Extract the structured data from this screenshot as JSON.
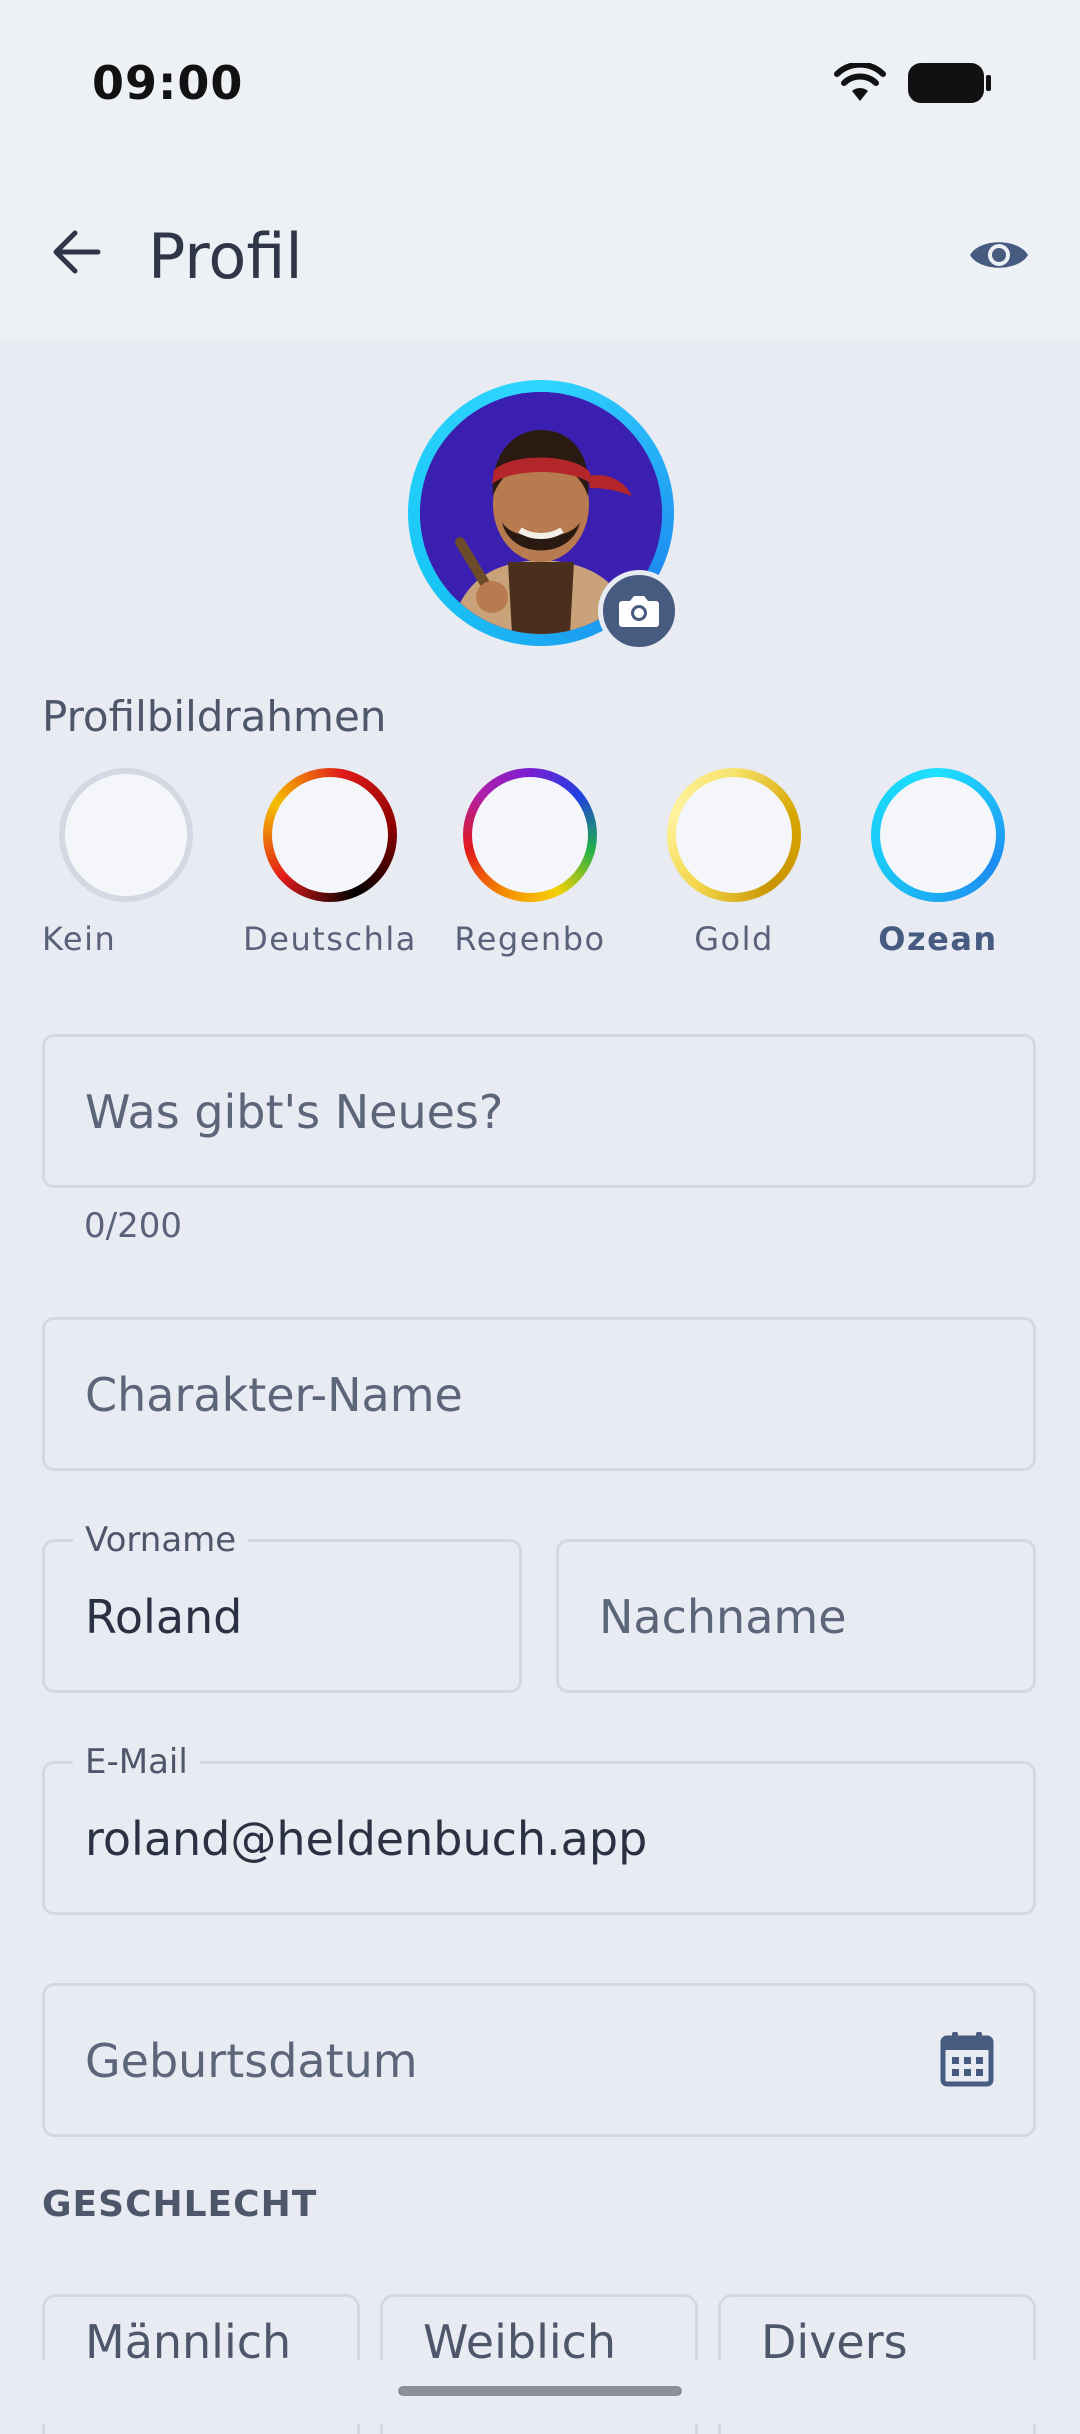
{
  "status_bar": {
    "time": "09:00",
    "wifi_icon": "wifi-icon",
    "battery_icon": "battery-icon"
  },
  "app_bar": {
    "title": "Profil",
    "back_icon": "arrow-left-icon",
    "preview_icon": "eye-icon"
  },
  "avatar": {
    "ring_colors": [
      "#2fd6ff",
      "#1e8cf0"
    ],
    "camera_icon": "camera-icon"
  },
  "frames": {
    "label": "Profilbildrahmen",
    "items": [
      {
        "label": "Kein",
        "selected": false
      },
      {
        "label": "Deutschla",
        "selected": false
      },
      {
        "label": "Regenbo",
        "selected": false
      },
      {
        "label": "Gold",
        "selected": false
      },
      {
        "label": "Ozean",
        "selected": true
      }
    ]
  },
  "status_field": {
    "placeholder": "Was gibt's Neues?",
    "counter": "0/200"
  },
  "character_field": {
    "placeholder": "Charakter-Name"
  },
  "first_name": {
    "label": "Vorname",
    "value": "Roland"
  },
  "last_name": {
    "placeholder": "Nachname"
  },
  "email": {
    "label": "E-Mail",
    "value": "roland@heldenbuch.app"
  },
  "birthdate": {
    "placeholder": "Geburtsdatum",
    "icon": "calendar-icon"
  },
  "gender": {
    "title": "GESCHLECHT",
    "options": [
      "Männlich",
      "Weiblich",
      "Divers"
    ]
  },
  "colors": {
    "accent": "#475a80",
    "background": "#e8ecf2",
    "border": "#d3d9e3"
  }
}
